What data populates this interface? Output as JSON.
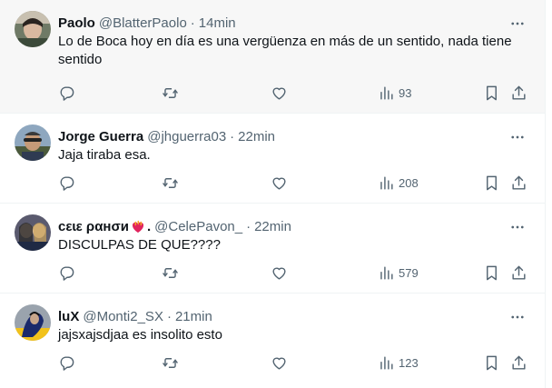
{
  "colors": {
    "text_primary": "#0f1419",
    "text_secondary": "#536471",
    "divider": "#eff3f4",
    "highlight_background": "#f7f7f7"
  },
  "tweets": [
    {
      "display_name": "Paolo",
      "handle": "@BlatterPaolo",
      "separator": "·",
      "time": "14min",
      "text": "Lo de Boca hoy en día es una vergüenza en más de un sentido, nada tiene sentido",
      "views": "93",
      "highlighted": true
    },
    {
      "display_name": "Jorge Guerra",
      "handle": "@jhguerra03",
      "separator": "·",
      "time": "22min",
      "text": "Jaja tiraba esa.",
      "views": "208",
      "highlighted": false
    },
    {
      "display_name": "ϲεɩε ραнσи",
      "display_name_suffix": ".",
      "handle": "@CelePavon_",
      "separator": "·",
      "time": "22min",
      "text": "DISCULPAS DE QUE????",
      "views": "579",
      "highlighted": false
    },
    {
      "display_name": "luX",
      "handle": "@Monti2_SX",
      "separator": "·",
      "time": "21min",
      "text": "jajsxajsdjaa es insolito esto",
      "views": "123",
      "highlighted": false
    }
  ],
  "icons": {
    "more": "more-horizontal-icon",
    "reply": "reply-icon",
    "retweet": "retweet-icon",
    "like": "heart-icon",
    "views": "views-chart-icon",
    "bookmark": "bookmark-icon",
    "share": "share-icon"
  }
}
